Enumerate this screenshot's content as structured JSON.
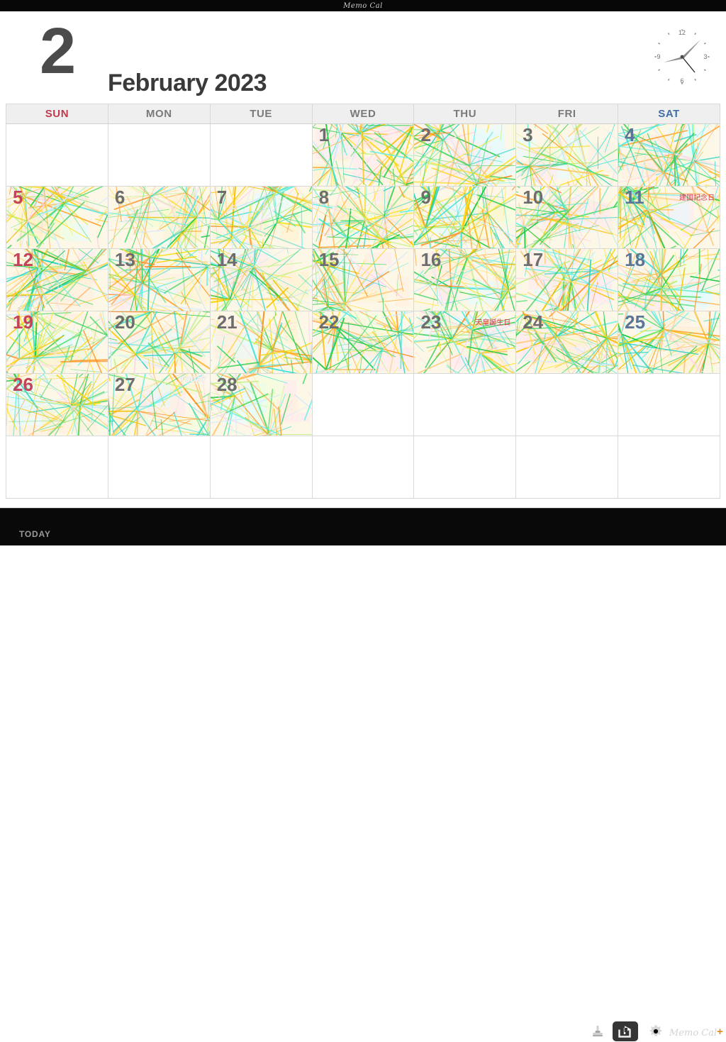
{
  "window": {
    "title": "Memo Cal"
  },
  "header": {
    "month_number": "2",
    "month_title": "February 2023",
    "clock": {
      "numerals": [
        "12",
        "3",
        "6",
        "9"
      ],
      "hour_hand_deg": 52,
      "minute_hand_deg": 232
    }
  },
  "calendar": {
    "weekdays": [
      {
        "label": "SUN",
        "kind": "sun"
      },
      {
        "label": "MON",
        "kind": "weekday"
      },
      {
        "label": "TUE",
        "kind": "weekday"
      },
      {
        "label": "WED",
        "kind": "weekday"
      },
      {
        "label": "THU",
        "kind": "weekday"
      },
      {
        "label": "FRI",
        "kind": "weekday"
      },
      {
        "label": "SAT",
        "kind": "sat"
      }
    ],
    "weeks": [
      [
        {
          "day": "",
          "kind": "sun",
          "filled": false
        },
        {
          "day": "",
          "kind": "weekday",
          "filled": false
        },
        {
          "day": "",
          "kind": "weekday",
          "filled": false
        },
        {
          "day": "1",
          "kind": "weekday",
          "filled": true
        },
        {
          "day": "2",
          "kind": "weekday",
          "filled": true
        },
        {
          "day": "3",
          "kind": "weekday",
          "filled": true
        },
        {
          "day": "4",
          "kind": "sat",
          "filled": true
        }
      ],
      [
        {
          "day": "5",
          "kind": "sun",
          "filled": true
        },
        {
          "day": "6",
          "kind": "weekday",
          "filled": true
        },
        {
          "day": "7",
          "kind": "weekday",
          "filled": true
        },
        {
          "day": "8",
          "kind": "weekday",
          "filled": true
        },
        {
          "day": "9",
          "kind": "weekday",
          "filled": true
        },
        {
          "day": "10",
          "kind": "weekday",
          "filled": true
        },
        {
          "day": "11",
          "kind": "sat",
          "filled": true,
          "holiday": "建国記念日"
        }
      ],
      [
        {
          "day": "12",
          "kind": "sun",
          "filled": true
        },
        {
          "day": "13",
          "kind": "weekday",
          "filled": true
        },
        {
          "day": "14",
          "kind": "weekday",
          "filled": true
        },
        {
          "day": "15",
          "kind": "weekday",
          "filled": true
        },
        {
          "day": "16",
          "kind": "weekday",
          "filled": true
        },
        {
          "day": "17",
          "kind": "weekday",
          "filled": true
        },
        {
          "day": "18",
          "kind": "sat",
          "filled": true
        }
      ],
      [
        {
          "day": "19",
          "kind": "sun",
          "filled": true
        },
        {
          "day": "20",
          "kind": "weekday",
          "filled": true
        },
        {
          "day": "21",
          "kind": "weekday",
          "filled": true
        },
        {
          "day": "22",
          "kind": "weekday",
          "filled": true
        },
        {
          "day": "23",
          "kind": "weekday",
          "filled": true,
          "holiday": "天皇誕生日"
        },
        {
          "day": "24",
          "kind": "weekday",
          "filled": true
        },
        {
          "day": "25",
          "kind": "sat",
          "filled": true
        }
      ],
      [
        {
          "day": "26",
          "kind": "sun",
          "filled": true
        },
        {
          "day": "27",
          "kind": "weekday",
          "filled": true,
          "today": "TODAY"
        },
        {
          "day": "28",
          "kind": "weekday",
          "filled": true
        },
        {
          "day": "",
          "kind": "weekday",
          "filled": false
        },
        {
          "day": "",
          "kind": "weekday",
          "filled": false
        },
        {
          "day": "",
          "kind": "weekday",
          "filled": false
        },
        {
          "day": "",
          "kind": "sat",
          "filled": false
        }
      ],
      [
        {
          "day": "",
          "kind": "sun",
          "filled": false
        },
        {
          "day": "",
          "kind": "weekday",
          "filled": false
        },
        {
          "day": "",
          "kind": "weekday",
          "filled": false
        },
        {
          "day": "",
          "kind": "weekday",
          "filled": false
        },
        {
          "day": "",
          "kind": "weekday",
          "filled": false
        },
        {
          "day": "",
          "kind": "weekday",
          "filled": false
        },
        {
          "day": "",
          "kind": "sat",
          "filled": false
        }
      ]
    ]
  },
  "toolbar": {
    "today_label": "TODAY",
    "icons": [
      "stamp-icon",
      "share-icon",
      "gear-icon"
    ],
    "brand": "Memo Cal",
    "brand_plus": "+"
  },
  "colors": {
    "sunday": "#c2435a",
    "saturday": "#5a7596",
    "weekday": "#6d6d6d",
    "holiday": "#d2394c",
    "accent_orange": "#e08a1e",
    "toolbar_bg": "#090909",
    "header_bg": "#efefef"
  }
}
